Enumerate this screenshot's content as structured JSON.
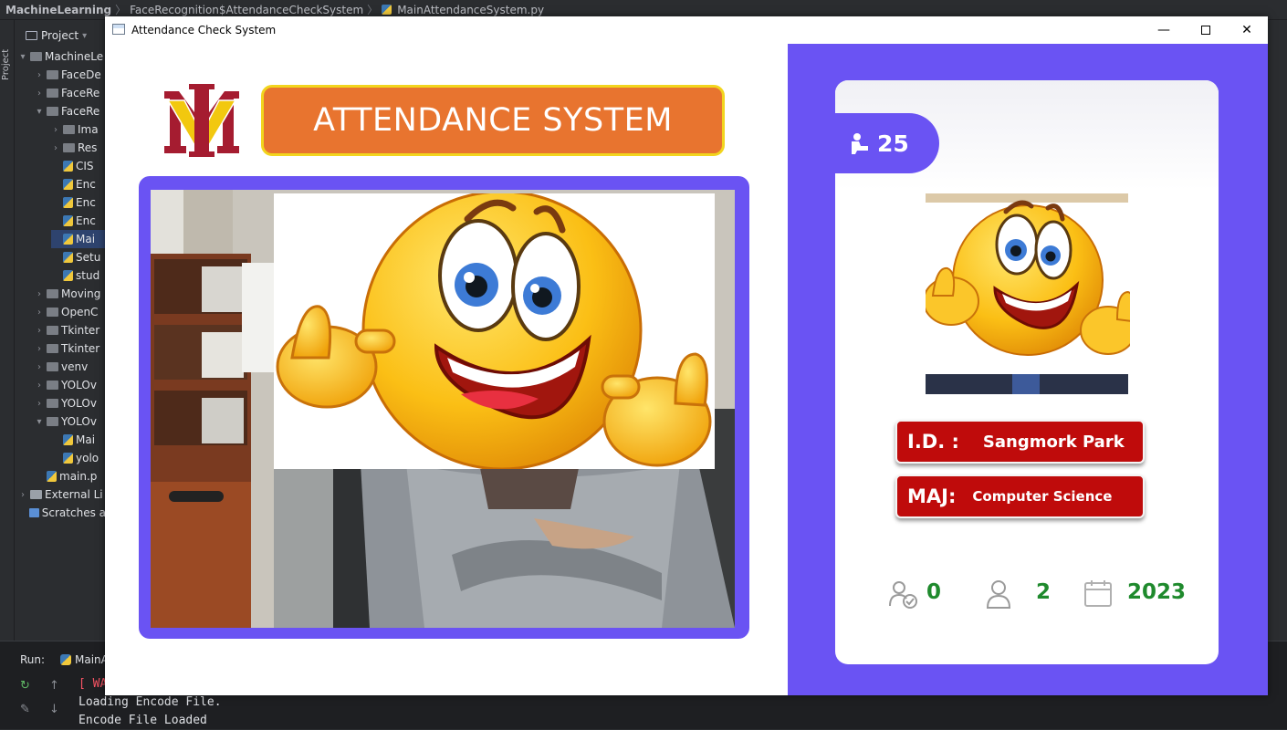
{
  "ide": {
    "breadcrumb": [
      "MachineLearning",
      "FaceRecognition$AttendanceCheckSystem",
      "MainAttendanceSystem.py"
    ],
    "sidebar_label": "Project",
    "project_header": "Project",
    "tree": [
      {
        "label": "MachineLe",
        "indent": 0,
        "arrow": "▾",
        "icon": "folder"
      },
      {
        "label": "FaceDe",
        "indent": 1,
        "arrow": "›",
        "icon": "folder"
      },
      {
        "label": "FaceRe",
        "indent": 1,
        "arrow": "›",
        "icon": "folder"
      },
      {
        "label": "FaceRe",
        "indent": 1,
        "arrow": "▾",
        "icon": "folder"
      },
      {
        "label": "Ima",
        "indent": 2,
        "arrow": "›",
        "icon": "folder"
      },
      {
        "label": "Res",
        "indent": 2,
        "arrow": "›",
        "icon": "folder"
      },
      {
        "label": "CIS",
        "indent": 2,
        "arrow": "",
        "icon": "py"
      },
      {
        "label": "Enc",
        "indent": 2,
        "arrow": "",
        "icon": "py"
      },
      {
        "label": "Enc",
        "indent": 2,
        "arrow": "",
        "icon": "py"
      },
      {
        "label": "Enc",
        "indent": 2,
        "arrow": "",
        "icon": "py"
      },
      {
        "label": "Mai",
        "indent": 2,
        "arrow": "",
        "icon": "py",
        "selected": true
      },
      {
        "label": "Setu",
        "indent": 2,
        "arrow": "",
        "icon": "py"
      },
      {
        "label": "stud",
        "indent": 2,
        "arrow": "",
        "icon": "py"
      },
      {
        "label": "Moving",
        "indent": 1,
        "arrow": "›",
        "icon": "folder"
      },
      {
        "label": "OpenC",
        "indent": 1,
        "arrow": "›",
        "icon": "folder"
      },
      {
        "label": "Tkinter",
        "indent": 1,
        "arrow": "›",
        "icon": "folder"
      },
      {
        "label": "Tkinter",
        "indent": 1,
        "arrow": "›",
        "icon": "folder"
      },
      {
        "label": "venv",
        "indent": 1,
        "arrow": "›",
        "icon": "folder"
      },
      {
        "label": "YOLOv",
        "indent": 1,
        "arrow": "›",
        "icon": "folder"
      },
      {
        "label": "YOLOv",
        "indent": 1,
        "arrow": "›",
        "icon": "folder"
      },
      {
        "label": "YOLOv",
        "indent": 1,
        "arrow": "▾",
        "icon": "folder"
      },
      {
        "label": "Mai",
        "indent": 2,
        "arrow": "",
        "icon": "py"
      },
      {
        "label": "yolo",
        "indent": 2,
        "arrow": "",
        "icon": "py"
      },
      {
        "label": "main.p",
        "indent": 1,
        "arrow": "",
        "icon": "py"
      },
      {
        "label": "External Li",
        "indent": 0,
        "arrow": "›",
        "icon": "lib"
      },
      {
        "label": "Scratches a",
        "indent": 0,
        "arrow": "",
        "icon": "scratch"
      }
    ],
    "run_label": "Run:",
    "run_tab": "MainA",
    "console": [
      {
        "text": "[ WA",
        "type": "warn"
      },
      {
        "text": "Loading Encode File.",
        "type": "normal"
      },
      {
        "text": "Encode File Loaded",
        "type": "normal"
      }
    ]
  },
  "window": {
    "title": "Attendance Check System",
    "controls": {
      "minimize": "—",
      "close": "✕"
    }
  },
  "app": {
    "banner_title": "ATTENDANCE SYSTEM",
    "logo_letters": "VM",
    "attendance_count": "25",
    "id_label": "I.D. :",
    "id_value": "Sangmork Park",
    "major_label": "MAJ:",
    "major_value": "Computer Science",
    "stats": [
      {
        "icon": "user-check-icon",
        "value": "0"
      },
      {
        "icon": "user-icon",
        "value": "2"
      },
      {
        "icon": "calendar-icon",
        "value": "2023"
      }
    ]
  },
  "colors": {
    "panel_purple": "#6a53f3",
    "banner_orange": "#e8742f",
    "banner_border": "#f2d51e",
    "field_red": "#bf0b0b",
    "stat_green": "#1f8a2d"
  }
}
